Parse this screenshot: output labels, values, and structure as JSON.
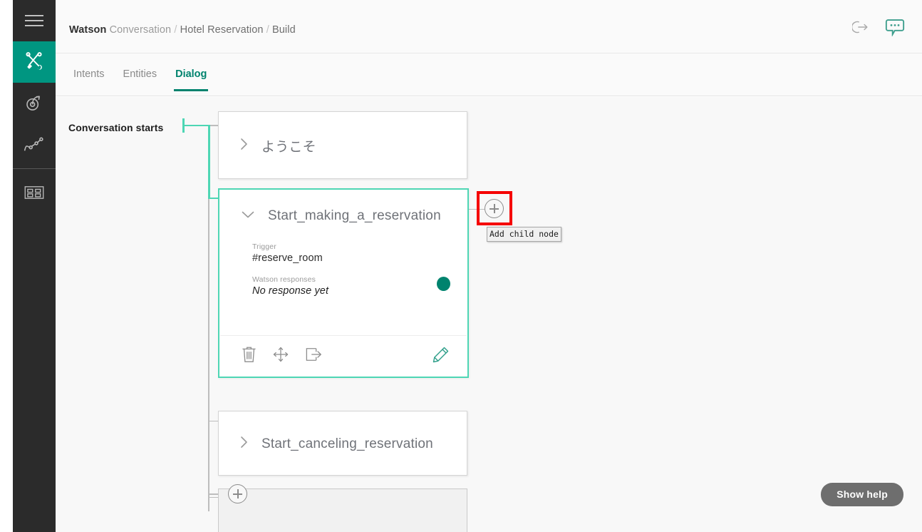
{
  "window": {
    "app_name": "Watson Conversation",
    "canvas_bg": "#f8f8f8",
    "accent_teal": "#00836e",
    "connector_teal": "#4ed6b4",
    "rail_bg": "#2b2b2b",
    "highlight_red": "#f50000"
  },
  "header": {
    "breadcrumb": {
      "product_bold": "Watson",
      "product_rest": "Conversation",
      "sep1": "/",
      "workspace": "Hotel Reservation",
      "sep2": "/",
      "section": "Build"
    },
    "actions": [
      {
        "name": "logout-icon",
        "label": "Log out"
      },
      {
        "name": "chat-icon",
        "label": "Try it out"
      }
    ]
  },
  "sidebar": {
    "items": [
      {
        "icon": "hamburger-menu-icon",
        "label": "Menu",
        "active": false
      },
      {
        "icon": "tools-icon",
        "label": "Build",
        "active": true
      },
      {
        "icon": "deploy-icon",
        "label": "Deploy",
        "active": false
      },
      {
        "icon": "analytics-icon",
        "label": "Improve",
        "active": false
      },
      {
        "icon": "grid-apps-icon",
        "label": "Workspaces",
        "active": false
      }
    ]
  },
  "tabs": [
    {
      "label": "Intents",
      "active": false
    },
    {
      "label": "Entities",
      "active": false
    },
    {
      "label": "Dialog",
      "active": true
    }
  ],
  "canvas": {
    "start_label": "Conversation starts",
    "nodes": [
      {
        "title": "ようこそ",
        "state": "collapsed",
        "selected": false,
        "chevron": "chevron-right-icon"
      },
      {
        "title": "Start_making_a_reservation",
        "state": "expanded",
        "selected": true,
        "chevron": "chevron-down-icon",
        "trigger_label": "Trigger",
        "trigger_value": "#reserve_room",
        "responses_label": "Watson responses",
        "responses_value": "No response yet",
        "response_status_color": "#00836e",
        "footer_actions": [
          {
            "name": "delete-node-icon",
            "label": "Delete"
          },
          {
            "name": "move-node-icon",
            "label": "Move"
          },
          {
            "name": "jump-to-icon",
            "label": "Jump to"
          },
          {
            "name": "edit-node-icon",
            "label": "Edit"
          }
        ]
      },
      {
        "title": "Start_canceling_reservation",
        "state": "collapsed",
        "selected": false,
        "chevron": "chevron-right-icon"
      },
      {
        "title": "",
        "state": "collapsed",
        "selected": false,
        "chevron": ""
      }
    ],
    "add_buttons": [
      {
        "name": "add-child-node-button",
        "label": "Add child node",
        "highlighted": true
      },
      {
        "name": "add-sibling-node-button",
        "label": "Add node",
        "highlighted": false
      }
    ],
    "tooltip": {
      "text": "Add child node",
      "visible": true
    }
  },
  "footer": {
    "show_help_label": "Show help"
  }
}
